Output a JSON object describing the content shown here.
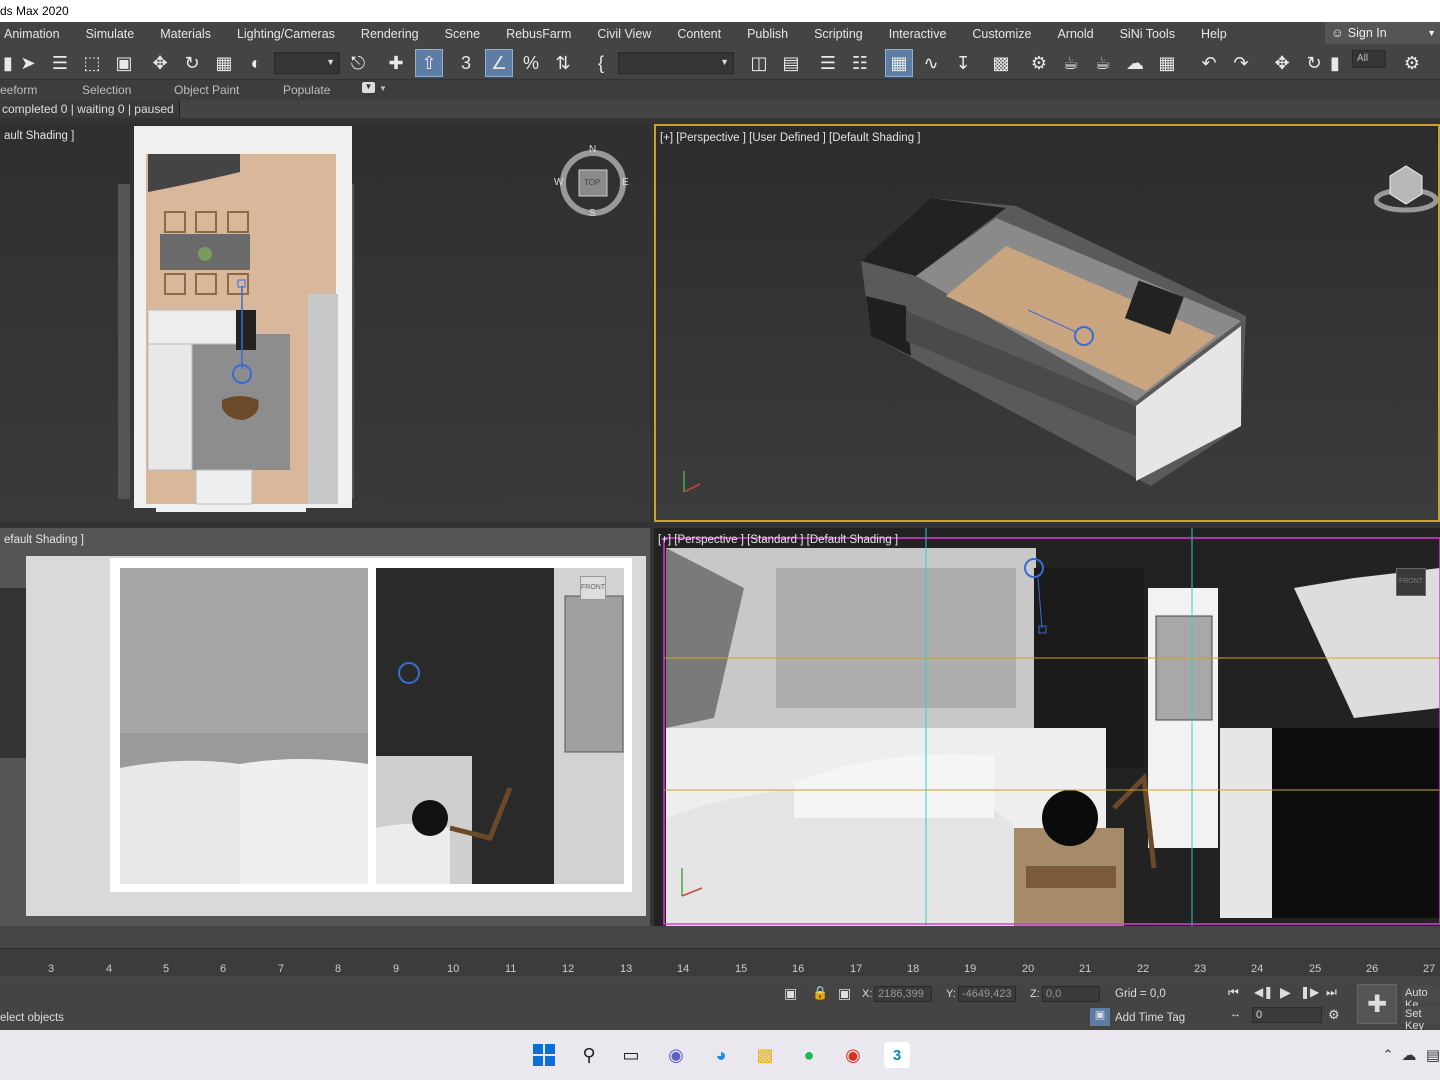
{
  "window": {
    "title": "ds Max 2020"
  },
  "menu": {
    "items": [
      "Animation",
      "Simulate",
      "Materials",
      "Lighting/Cameras",
      "Rendering",
      "Scene",
      "RebusFarm",
      "Civil View",
      "Content",
      "Publish",
      "Scripting",
      "Interactive",
      "Customize",
      "Arnold",
      "SiNi Tools",
      "Help"
    ],
    "sign_in": "Sign In"
  },
  "toolbar": {
    "selection_filter": "All"
  },
  "ribbon": {
    "tabs": [
      "eeform",
      "Selection",
      "Object Paint",
      "Populate"
    ]
  },
  "rebus_status": "completed 0 | waiting 0 | paused 0",
  "viewports": {
    "top": {
      "label": "ault Shading ]",
      "compass": {
        "n": "N",
        "s": "S",
        "e": "E",
        "w": "W",
        "cube": "TOP"
      }
    },
    "persp1": {
      "label": "[+] [Perspective ] [User Defined ] [Default Shading ]"
    },
    "front": {
      "label": "efault Shading ]",
      "cube": "FRONT"
    },
    "persp2": {
      "label": "[+] [Perspective ] [Standard ] [Default Shading ]",
      "cube": "FRONT"
    }
  },
  "timeline": {
    "ticks": [
      "3",
      "4",
      "5",
      "6",
      "7",
      "8",
      "9",
      "10",
      "11",
      "12",
      "13",
      "14",
      "15",
      "16",
      "17",
      "18",
      "19",
      "20",
      "21",
      "22",
      "23",
      "24",
      "25",
      "26",
      "27"
    ]
  },
  "status": {
    "prompt": "elect objects",
    "x_label": "X:",
    "x_value": "2186,399",
    "y_label": "Y:",
    "y_value": "-4649,423",
    "z_label": "Z:",
    "z_value": "0,0",
    "grid": "Grid = 0,0",
    "add_time_tag": "Add Time Tag",
    "frame": "0",
    "auto_key": "Auto Ke",
    "set_key": "Set Key"
  },
  "colors": {
    "accent": "#5e7da4",
    "viewport_border_active": "#c9a227",
    "viewport_border_persp2": "#d43fd4"
  }
}
